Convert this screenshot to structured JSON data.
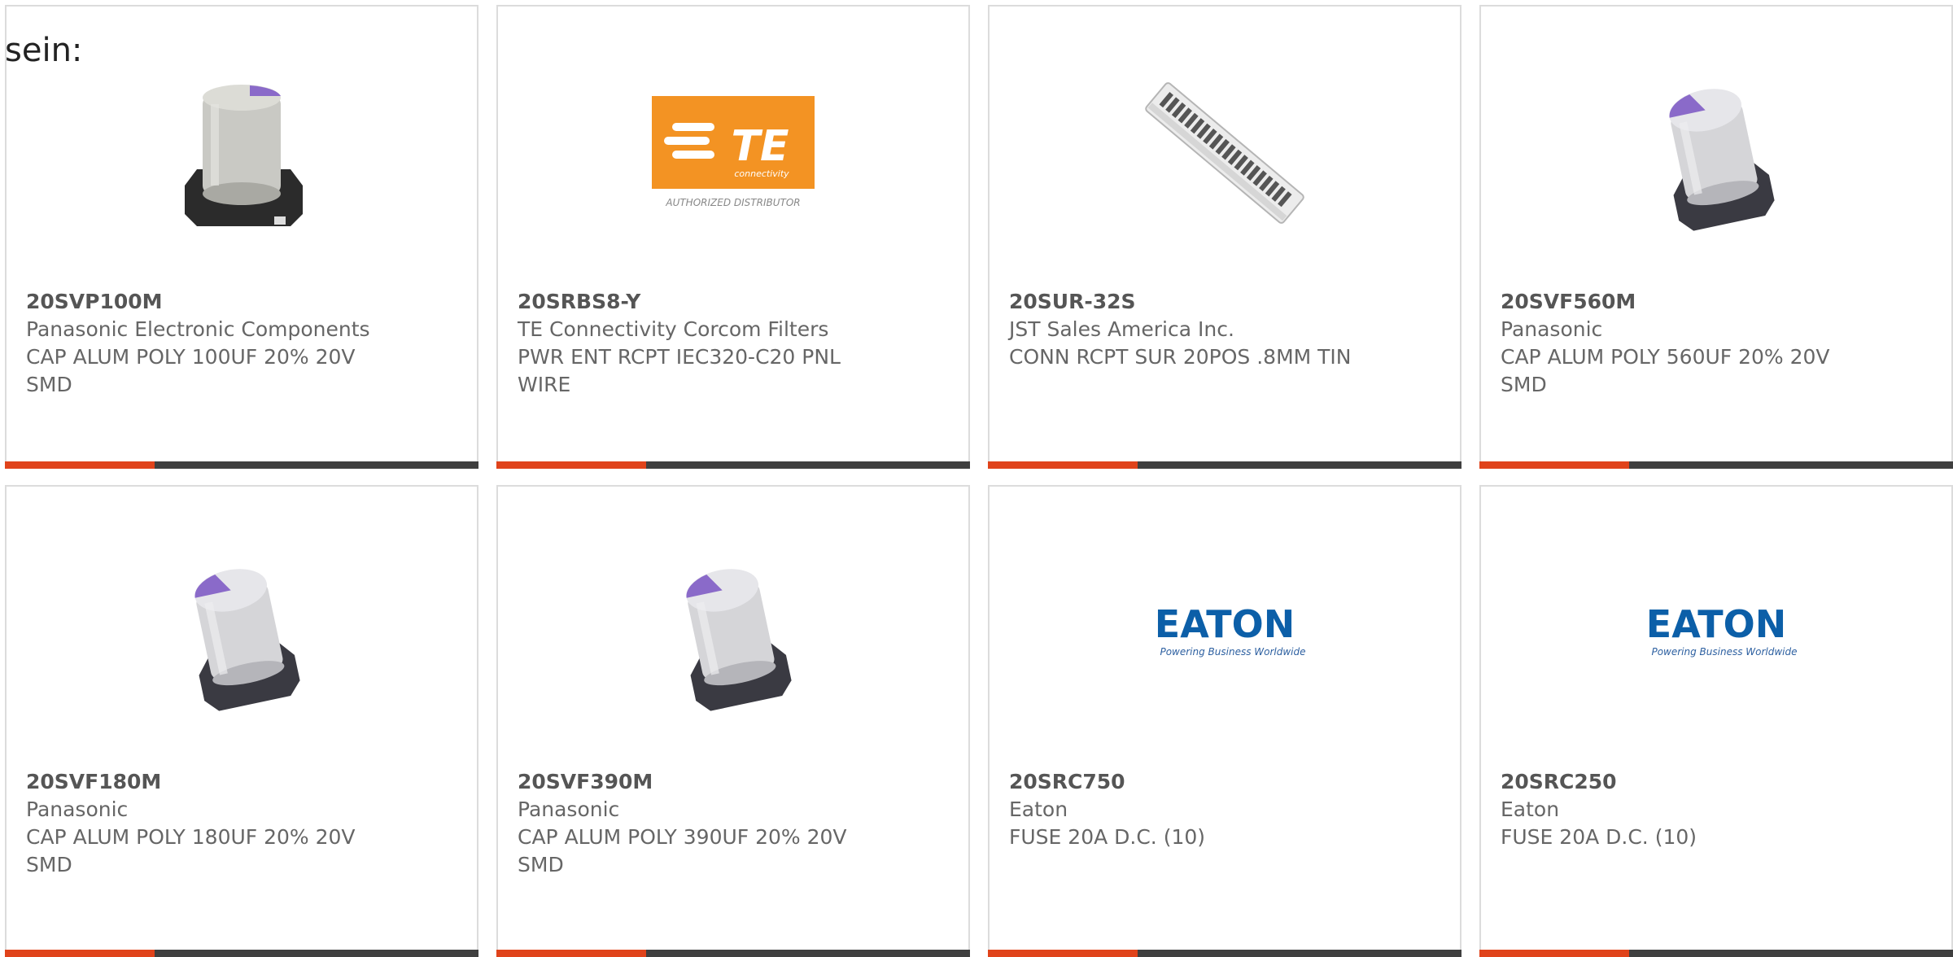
{
  "intro_text": "sein:",
  "brand_colors": {
    "accent": "#e0431b",
    "bar": "#3f3f3f",
    "te_orange": "#f39323",
    "eaton_blue": "#0c5fa8",
    "cap_purple": "#8a6ac9"
  },
  "products": [
    {
      "part_number": "20SVP100M",
      "manufacturer": "Panasonic Electronic Components",
      "description": "CAP ALUM POLY 100UF 20% 20V SMD",
      "image": "capacitor-gray-icon"
    },
    {
      "part_number": "20SRBS8-Y",
      "manufacturer": "TE Connectivity Corcom Filters",
      "description": "PWR ENT RCPT IEC320-C20 PNL WIRE",
      "image": "te-connectivity-logo",
      "logo_text": "TE",
      "logo_subtext": "connectivity",
      "logo_caption": "AUTHORIZED DISTRIBUTOR"
    },
    {
      "part_number": "20SUR-32S",
      "manufacturer": "JST Sales America Inc.",
      "description": "CONN RCPT SUR 20POS .8MM TIN",
      "image": "connector-strip-icon"
    },
    {
      "part_number": "20SVF560M",
      "manufacturer": "Panasonic",
      "description": "CAP ALUM POLY 560UF 20% 20V SMD",
      "image": "capacitor-silver-icon"
    },
    {
      "part_number": "20SVF180M",
      "manufacturer": "Panasonic",
      "description": "CAP ALUM POLY 180UF 20% 20V SMD",
      "image": "capacitor-silver-icon"
    },
    {
      "part_number": "20SVF390M",
      "manufacturer": "Panasonic",
      "description": "CAP ALUM POLY 390UF 20% 20V SMD",
      "image": "capacitor-silver-icon"
    },
    {
      "part_number": "20SRC750",
      "manufacturer": "Eaton",
      "description": "FUSE 20A D.C. (10)",
      "image": "eaton-logo",
      "logo_text": "EATON",
      "logo_subtext": "Powering Business Worldwide"
    },
    {
      "part_number": "20SRC250",
      "manufacturer": "Eaton",
      "description": "FUSE 20A D.C. (10)",
      "image": "eaton-logo",
      "logo_text": "EATON",
      "logo_subtext": "Powering Business Worldwide"
    }
  ]
}
